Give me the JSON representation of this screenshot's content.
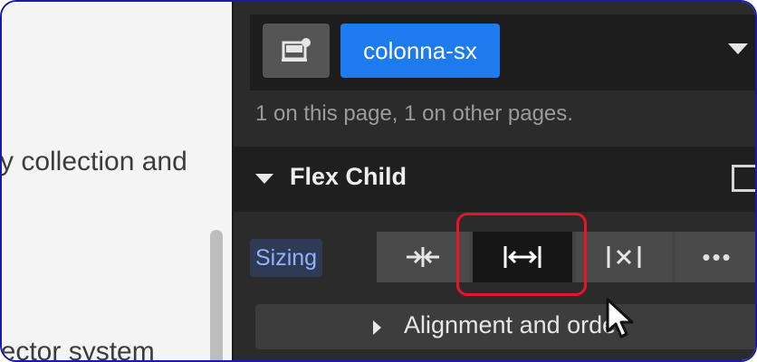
{
  "canvas": {
    "line1": "y collection and",
    "line2": "lector system"
  },
  "selector": {
    "element_icon": "element-icon",
    "class_name": "colonna-sx",
    "dropdown_icon": "chevron-down-icon",
    "usage_text": "1 on this page, 1 on other pages."
  },
  "flex_child": {
    "title": "Flex Child",
    "sizing_label": "Sizing",
    "options": [
      {
        "name": "shrink",
        "icon": "shrink-icon"
      },
      {
        "name": "grow",
        "icon": "grow-icon",
        "selected": true
      },
      {
        "name": "none",
        "icon": "no-shrink-grow-icon"
      },
      {
        "name": "more",
        "icon": "more-icon",
        "label": "•••"
      }
    ],
    "alignment_label": "Alignment and order"
  },
  "colors": {
    "accent": "#1e7bef",
    "highlight": "#e8142b",
    "panel_bg": "#2b2b2b"
  }
}
